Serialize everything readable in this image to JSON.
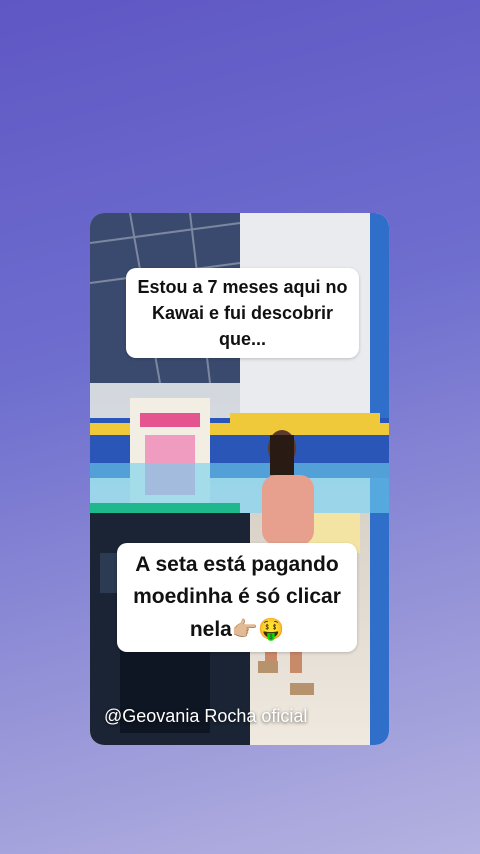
{
  "story": {
    "caption_top": "Estou a 7 meses aqui no Kawai e fui descobrir que...",
    "caption_bottom_text": "A seta está pagando moedinha é só clicar nela",
    "caption_bottom_emoji": "👉🏼🤑",
    "watermark": "@Geovania Rocha oficial"
  },
  "colors": {
    "background_top": "#5f57c4",
    "background_bottom": "#b4b2e0",
    "caption_bg": "#ffffff"
  }
}
